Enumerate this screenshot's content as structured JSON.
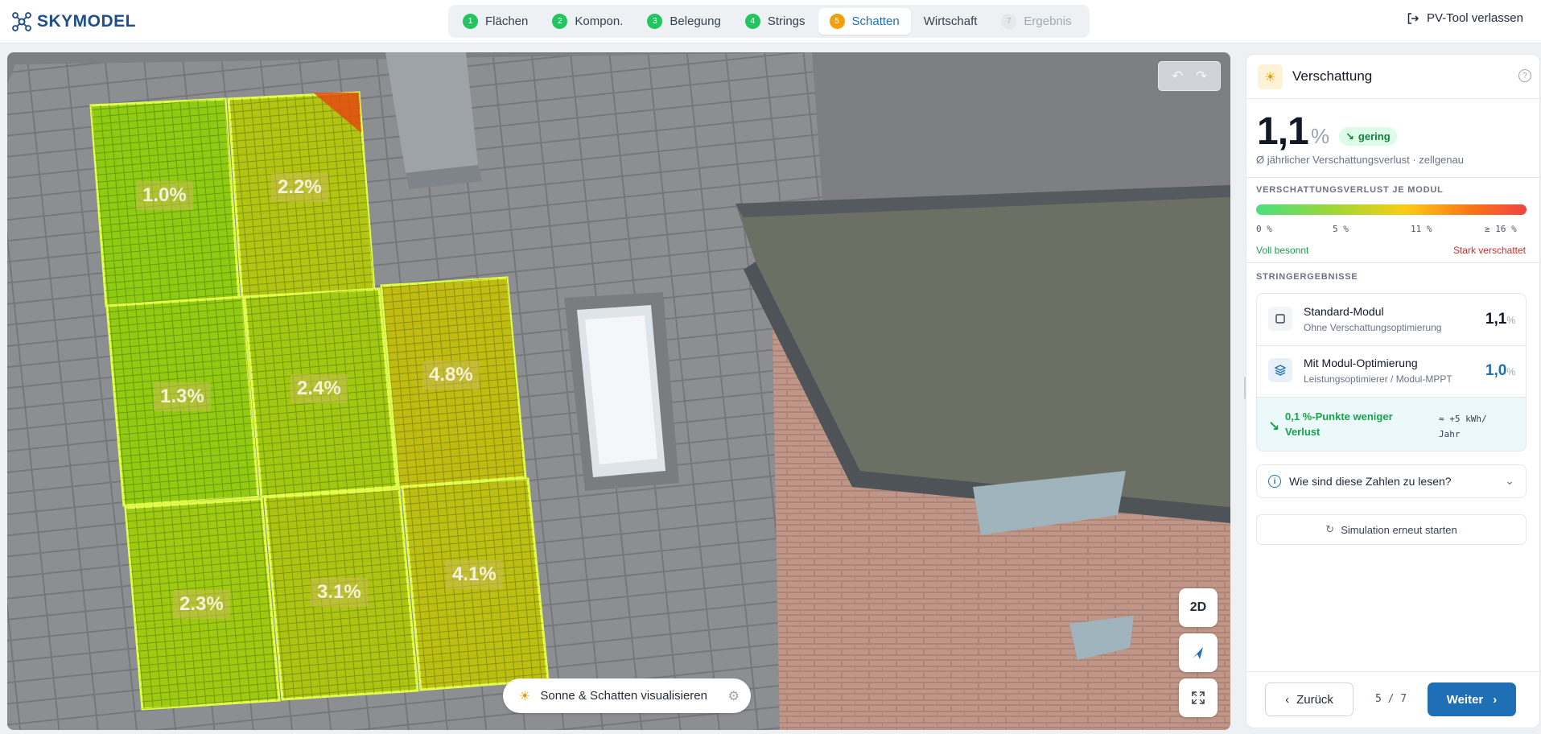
{
  "header": {
    "logo_text": "SKYMODEL",
    "exit_label": "PV-Tool verlassen",
    "steps": [
      {
        "num": "1",
        "label": "Flächen",
        "state": "done"
      },
      {
        "num": "2",
        "label": "Kompon.",
        "state": "done"
      },
      {
        "num": "3",
        "label": "Belegung",
        "state": "done"
      },
      {
        "num": "4",
        "label": "Strings",
        "state": "done"
      },
      {
        "num": "5",
        "label": "Schatten",
        "state": "current"
      },
      {
        "num": "6",
        "label": "Wirtschaft",
        "state": "next"
      },
      {
        "num": "7",
        "label": "Ergebnis",
        "state": "disabled"
      }
    ]
  },
  "viewer": {
    "modules": [
      {
        "label": "1.0%",
        "color": "#8fd400"
      },
      {
        "label": "2.2%",
        "color": "#b8cc00"
      },
      {
        "label": "1.3%",
        "color": "#94d300"
      },
      {
        "label": "2.4%",
        "color": "#a6d000"
      },
      {
        "label": "4.8%",
        "color": "#c9c200"
      },
      {
        "label": "2.3%",
        "color": "#a3d100"
      },
      {
        "label": "3.1%",
        "color": "#b4cc00"
      },
      {
        "label": "4.1%",
        "color": "#c5c600"
      }
    ],
    "view_2d_label": "2D",
    "sun_toggle_label": "Sonne & Schatten visualisieren"
  },
  "panel": {
    "title": "Verschattung",
    "big_value": "1,1",
    "big_unit": "%",
    "badge": "gering",
    "subcaption": "Ø jährlicher Verschattungsverlust · zellgenau",
    "per_module_title": "VERSCHATTUNGSVERLUST JE MODUL",
    "scale_ticks": [
      "0 %",
      "5 %",
      "11 %",
      "≥ 16 %"
    ],
    "scale_left": "Voll besonnt",
    "scale_right": "Stark verschattet",
    "string_title": "STRINGERGEBNISSE",
    "strings": [
      {
        "name": "Standard-Modul",
        "desc": "Ohne Verschattungsoptimierung",
        "value": "1,1",
        "unit": "%"
      },
      {
        "name": "Mit Modul-Optimierung",
        "desc": "Leistungsoptimierer / Modul-MPPT",
        "value": "1,0",
        "unit": "%"
      }
    ],
    "gain_text": "0,1 %-Punkte weniger Verlust",
    "gain_kwh": "≈ +5 kWh/ Jahr",
    "faq_label": "Wie sind diese Zahlen zu lesen?",
    "rerun_label": "Simulation erneut starten",
    "back_label": "Zurück",
    "pager": "5 / 7",
    "next_label": "Weiter"
  },
  "colors": {
    "accent": "#1e6fb5",
    "step_done": "#22c55e",
    "step_current": "#f59e0b",
    "good": "#16a34a",
    "bad": "#dc2626"
  }
}
